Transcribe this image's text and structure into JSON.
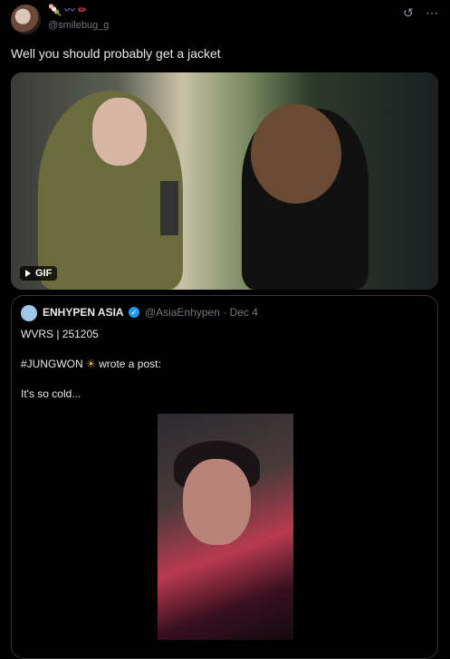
{
  "header": {
    "handle": "@smilebug_g",
    "name_icons": [
      "🍡",
      "〰",
      "✏"
    ]
  },
  "tweet": {
    "text": "Well you should probably get a jacket",
    "media_badge": "GIF"
  },
  "quote": {
    "name": "ENHYPEN ASIA",
    "handle": "@AsiaEnhypen",
    "date": "Dec 4",
    "line1": "WVRS | 251205",
    "line2_prefix": "#JUNGWON",
    "line2_suffix": "wrote a post:",
    "line3": "It's so cold..."
  },
  "colors": {
    "background": "#000000",
    "text": "#e7e9ea",
    "muted": "#71767b",
    "verified": "#1d9bf0"
  }
}
